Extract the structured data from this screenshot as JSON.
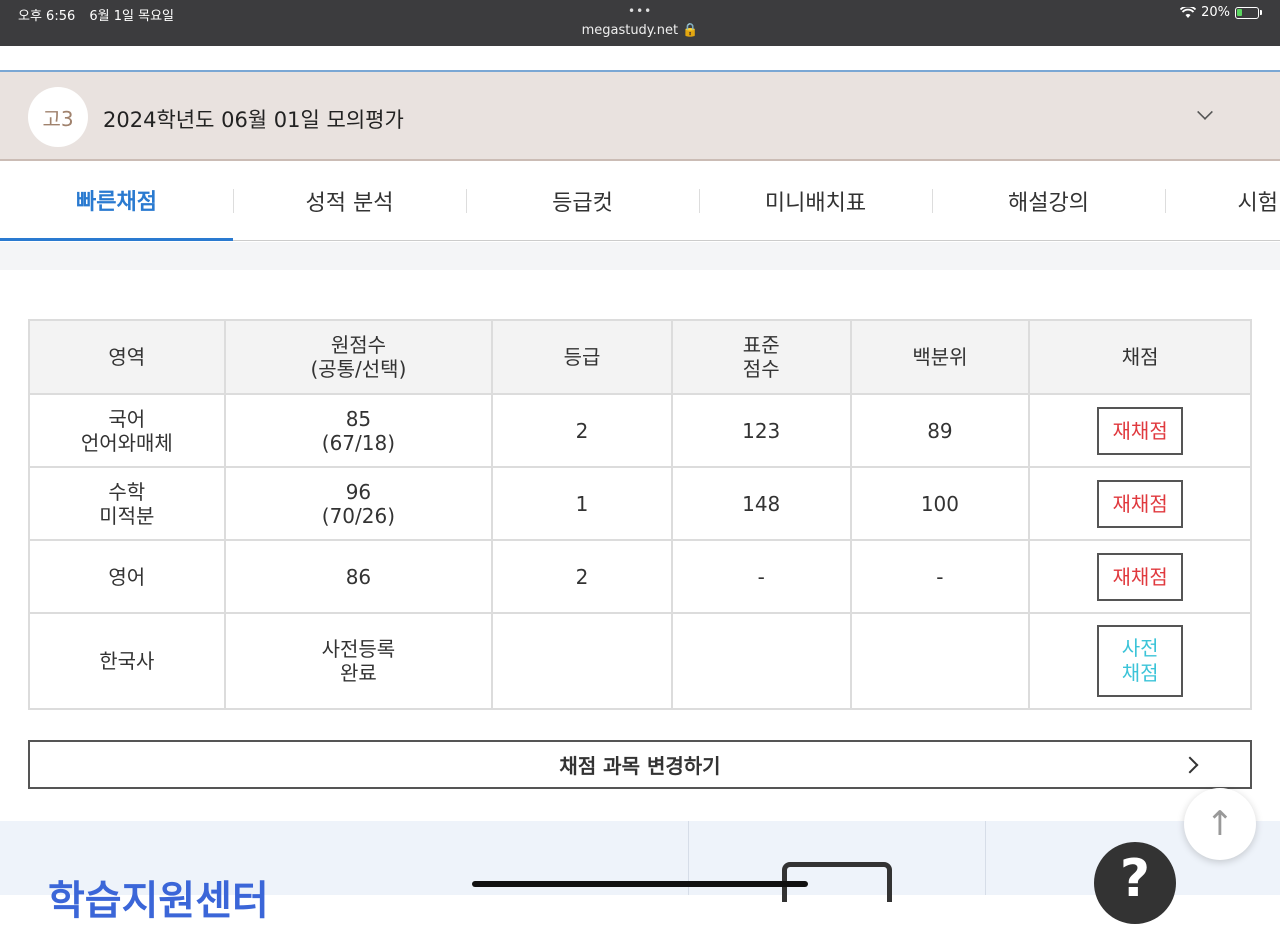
{
  "status_bar": {
    "time": "오후 6:56",
    "date": "6월 1일 목요일",
    "dots": "•••",
    "url": "megastudy.net 🔒",
    "battery_percent": "20%",
    "wifi_icon": "wifi-icon",
    "battery_icon": "battery-charging-icon"
  },
  "exam": {
    "grade_badge": "고3",
    "title": "2024학년도 06월 01일 모의평가",
    "expand_icon": "chevron-down-icon"
  },
  "tabs": [
    {
      "label": "빠른채점",
      "active": true
    },
    {
      "label": "성적 분석",
      "active": false
    },
    {
      "label": "등급컷",
      "active": false
    },
    {
      "label": "미니배치표",
      "active": false
    },
    {
      "label": "해설강의",
      "active": false
    },
    {
      "label": "시험",
      "active": false
    }
  ],
  "table": {
    "headers": {
      "area": "영역",
      "raw_line1": "원점수",
      "raw_line2": "(공통/선택)",
      "grade": "등급",
      "std_line1": "표준",
      "std_line2": "점수",
      "percentile": "백분위",
      "scoring": "채점"
    },
    "rows": [
      {
        "area_line1": "국어",
        "area_line2": "언어와매체",
        "raw_line1": "85",
        "raw_line2": "(67/18)",
        "grade": "2",
        "std": "123",
        "percentile": "89",
        "action": "재채점"
      },
      {
        "area_line1": "수학",
        "area_line2": "미적분",
        "raw_line1": "96",
        "raw_line2": "(70/26)",
        "grade": "1",
        "std": "148",
        "percentile": "100",
        "action": "재채점"
      },
      {
        "area_line1": "영어",
        "area_line2": "",
        "raw_line1": "86",
        "raw_line2": "",
        "grade": "2",
        "std": "-",
        "percentile": "-",
        "action": "재채점"
      },
      {
        "area_line1": "한국사",
        "area_line2": "",
        "raw_line1": "사전등록",
        "raw_line2": "완료",
        "grade": "",
        "std": "",
        "percentile": "",
        "action_line1": "사전",
        "action_line2": "채점"
      }
    ]
  },
  "change_subjects": {
    "label": "채점 과목 변경하기",
    "icon": "chevron-right-icon"
  },
  "bottom": {
    "center_title": "학습지원센터",
    "help_glyph": "?",
    "top_glyph": "↑"
  },
  "colors": {
    "accent_blue": "#2a7ad0",
    "rescore_red": "#e0393e",
    "pre_cyan": "#3cc4d8",
    "header_bg": "#e9e2df"
  }
}
